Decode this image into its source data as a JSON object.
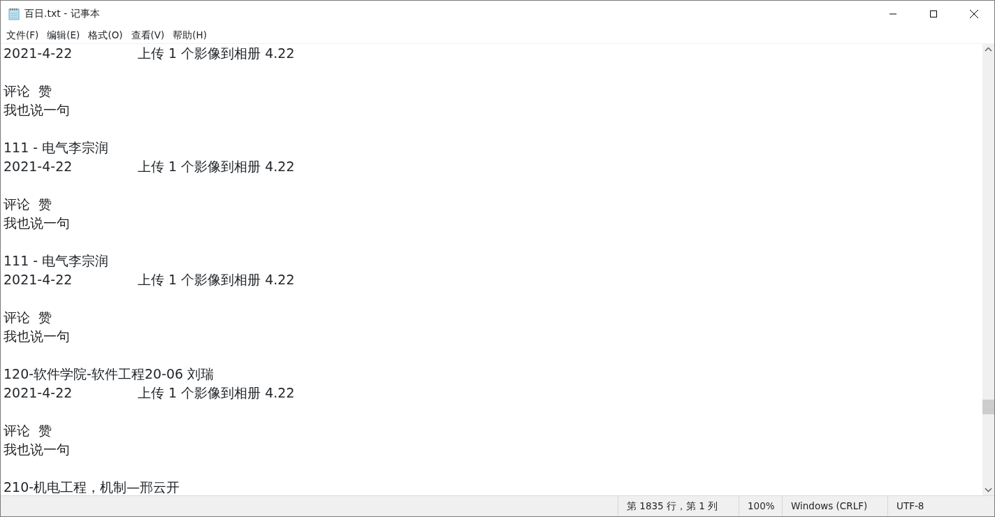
{
  "window": {
    "title": "百日.txt - 记事本"
  },
  "menu": [
    "文件(F)",
    "编辑(E)",
    "格式(O)",
    "查看(V)",
    "帮助(H)"
  ],
  "lines": [
    {
      "kind": "dated",
      "date": "2021-4-22",
      "text": "上传 1 个影像到相册 4.22"
    },
    {
      "kind": "blank"
    },
    {
      "kind": "text",
      "text": "评论  赞"
    },
    {
      "kind": "text",
      "text": "我也说一句"
    },
    {
      "kind": "blank"
    },
    {
      "kind": "text",
      "text": "111 - 电气李宗润"
    },
    {
      "kind": "dated",
      "date": "2021-4-22",
      "text": "上传 1 个影像到相册 4.22"
    },
    {
      "kind": "blank"
    },
    {
      "kind": "text",
      "text": "评论  赞"
    },
    {
      "kind": "text",
      "text": "我也说一句"
    },
    {
      "kind": "blank"
    },
    {
      "kind": "text",
      "text": "111 - 电气李宗润"
    },
    {
      "kind": "dated",
      "date": "2021-4-22",
      "text": "上传 1 个影像到相册 4.22"
    },
    {
      "kind": "blank"
    },
    {
      "kind": "text",
      "text": "评论  赞"
    },
    {
      "kind": "text",
      "text": "我也说一句"
    },
    {
      "kind": "blank"
    },
    {
      "kind": "text",
      "text": "120-软件学院-软件工程20-06 刘瑞"
    },
    {
      "kind": "dated",
      "date": "2021-4-22",
      "text": "上传 1 个影像到相册 4.22"
    },
    {
      "kind": "blank"
    },
    {
      "kind": "text",
      "text": "评论  赞"
    },
    {
      "kind": "text",
      "text": "我也说一句"
    },
    {
      "kind": "blank"
    },
    {
      "kind": "text",
      "text": "210-机电工程，机制—邢云开"
    }
  ],
  "status_bar": [
    "第 1835 行，第 1 列",
    "100%",
    "Windows (CRLF)",
    "UTF-8"
  ]
}
